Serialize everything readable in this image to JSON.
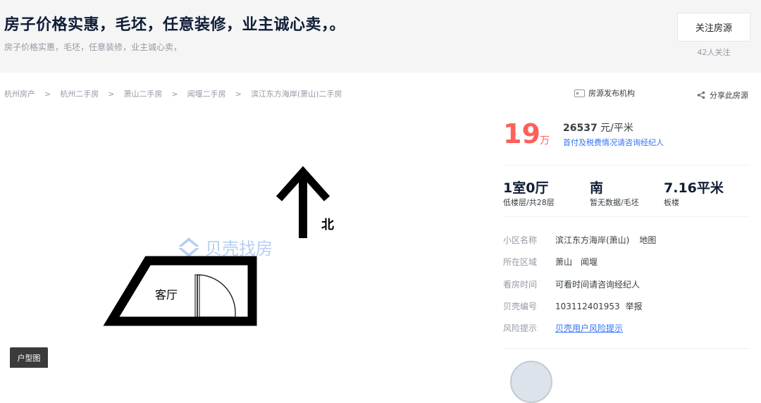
{
  "header": {
    "title": "房子价格实惠，毛坯，任意装修，业主诚心卖，。",
    "subtitle": "房子价格实惠，毛坯，任意装修，业主诚心卖，",
    "follow_label": "关注房源",
    "follow_count": "42人关注"
  },
  "breadcrumb": [
    "杭州房产",
    "杭州二手房",
    "萧山二手房",
    "闻堰二手房",
    "滨江东方海岸(萧山)二手房"
  ],
  "breadcrumb_sep": ">",
  "agency_label": "房源发布机构",
  "share_label": "分享此房源",
  "floorplan": {
    "watermark": "贝壳找房",
    "north_label": "北",
    "room_label": "客厅",
    "tag": "户型图"
  },
  "price": {
    "total": "19",
    "total_unit": "万",
    "unit_value": "26537",
    "unit_suffix": " 元/平米",
    "tax_note": "首付及税费情况请咨询经纪人"
  },
  "room_info": {
    "layout": "1室0厅",
    "floor": "低楼层/共28层",
    "orientation": "南",
    "decoration": "暂无数据/毛坯",
    "area": "7.16平米",
    "building_type": "板楼"
  },
  "details": {
    "community_label": "小区名称",
    "community_value": "滨江东方海岸(萧山)",
    "map_link": "地图",
    "district_label": "所在区域",
    "district_1": "萧山",
    "district_2": "闻堰",
    "visit_label": "看房时间",
    "visit_value": "可看时间请咨询经纪人",
    "id_label": "贝壳编号",
    "id_value": "103112401953",
    "report_link": "举报",
    "risk_label": "风险提示",
    "risk_link": "贝壳用户风险提示"
  },
  "colors": {
    "price_red": "#fe615a",
    "link_blue": "#3072f6",
    "header_bg": "#f5f5f5"
  }
}
